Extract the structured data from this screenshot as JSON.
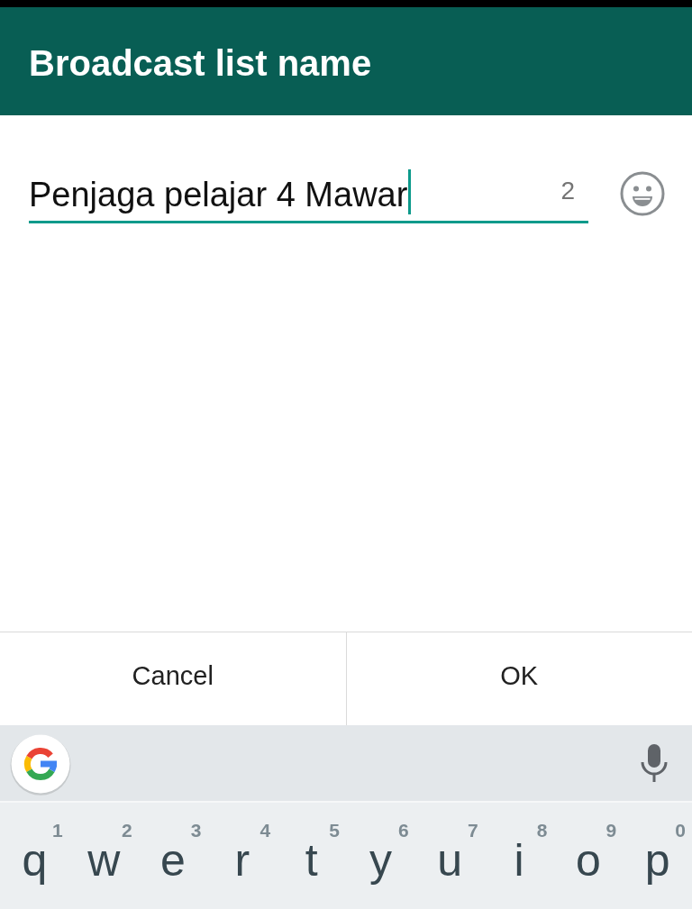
{
  "dialog": {
    "title": "Broadcast list name",
    "name_field": {
      "value": "Penjaga pelajar 4 Mawar",
      "counter": "2",
      "focused": true
    },
    "buttons": [
      "Cancel",
      "OK"
    ]
  },
  "keyboard": {
    "keys": [
      {
        "letter": "q",
        "hint": "1"
      },
      {
        "letter": "w",
        "hint": "2"
      },
      {
        "letter": "e",
        "hint": "3"
      },
      {
        "letter": "r",
        "hint": "4"
      },
      {
        "letter": "t",
        "hint": "5"
      },
      {
        "letter": "y",
        "hint": "6"
      },
      {
        "letter": "u",
        "hint": "7"
      },
      {
        "letter": "i",
        "hint": "8"
      },
      {
        "letter": "o",
        "hint": "9"
      },
      {
        "letter": "p",
        "hint": "0"
      }
    ]
  }
}
